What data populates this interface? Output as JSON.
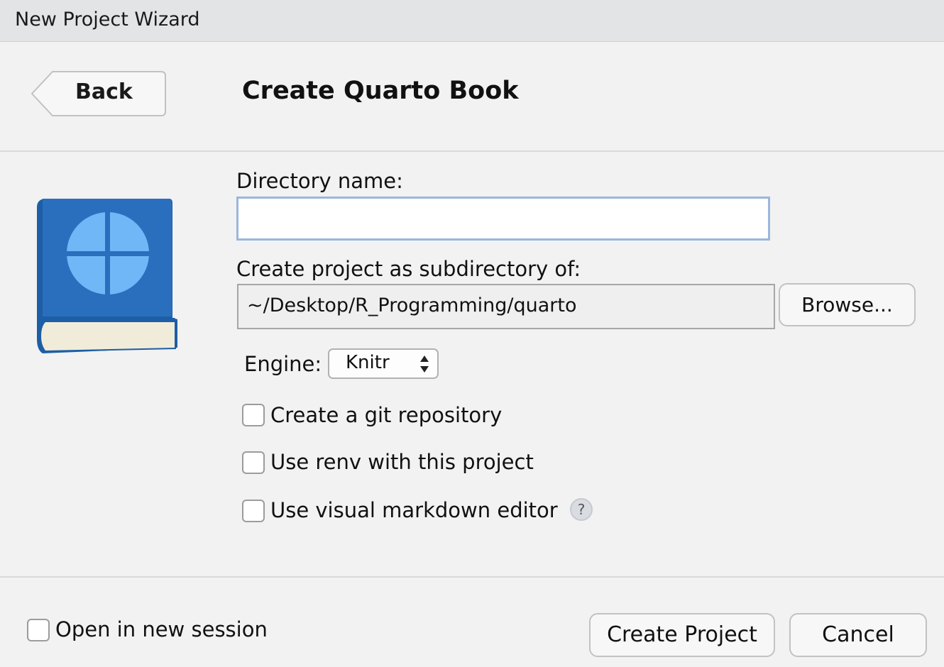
{
  "window": {
    "title": "New Project Wizard"
  },
  "header": {
    "back_label": "Back",
    "page_title": "Create Quarto Book"
  },
  "form": {
    "directory_name_label": "Directory name:",
    "directory_name_value": "",
    "subdirectory_label": "Create project as subdirectory of:",
    "subdirectory_path": "~/Desktop/R_Programming/quarto",
    "browse_label": "Browse...",
    "engine_label": "Engine:",
    "engine_value": "Knitr",
    "options": [
      {
        "label": "Create a git repository",
        "checked": false
      },
      {
        "label": "Use renv with this project",
        "checked": false
      },
      {
        "label": "Use visual markdown editor",
        "checked": false
      }
    ],
    "help_icon": "question-mark-icon"
  },
  "footer": {
    "open_new_session_label": "Open in new session",
    "open_new_session_checked": false,
    "create_label": "Create Project",
    "cancel_label": "Cancel"
  },
  "icons": {
    "book": "quarto-book-icon"
  },
  "colors": {
    "book_cover": "#2166b0",
    "book_logo": "#6fb7f7",
    "input_focus_border": "#9cb6dc"
  }
}
